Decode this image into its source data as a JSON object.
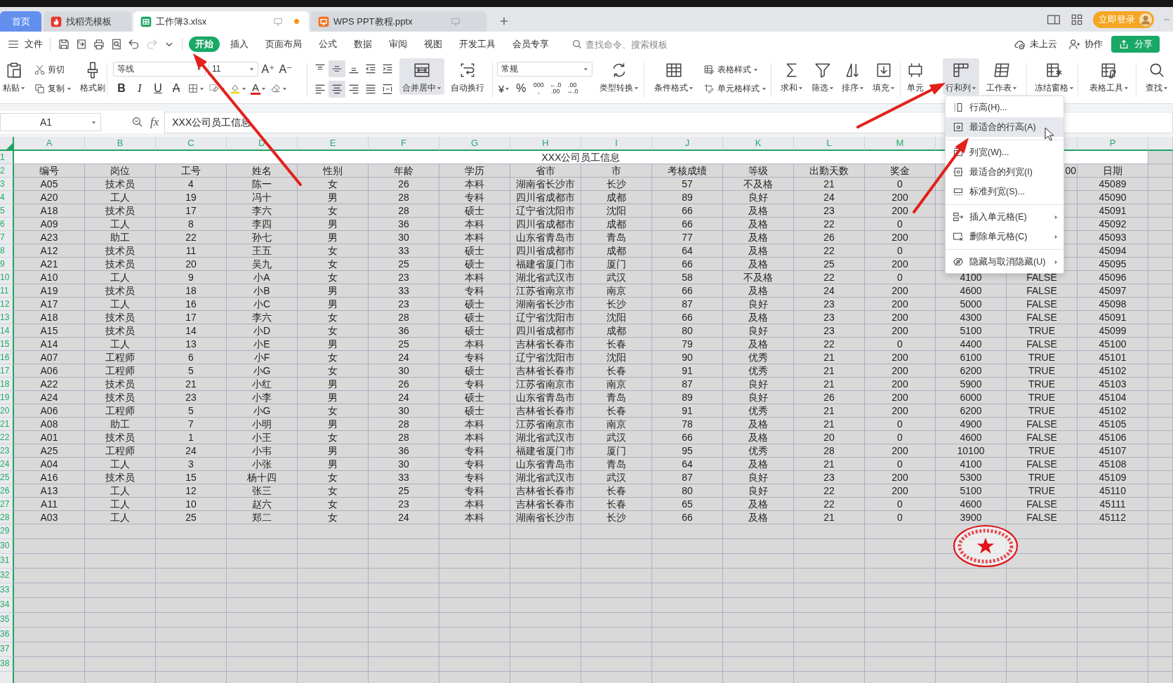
{
  "tab_bar": {
    "tabs": [
      {
        "label": "首页",
        "kind": "home",
        "selected": false
      },
      {
        "label": "找稻壳模板",
        "kind": "template",
        "selected": false
      },
      {
        "label": "工作簿3.xlsx",
        "kind": "sheet",
        "selected": true,
        "modified": true
      },
      {
        "label": "WPS PPT教程.pptx",
        "kind": "slides",
        "selected": false,
        "modified": false
      }
    ],
    "login": "立即登录"
  },
  "menu_bar": {
    "file": "文件",
    "quick_access": [
      {
        "disabled": false
      },
      {
        "disabled": false
      },
      {
        "disabled": false
      },
      {
        "disabled": false
      },
      {
        "disabled": false
      },
      {
        "disabled": true
      },
      {
        "disabled": false
      }
    ],
    "tabs": [
      {
        "label": "开始",
        "selected": true
      },
      {
        "label": "插入",
        "selected": false
      },
      {
        "label": "页面布局",
        "selected": false
      },
      {
        "label": "公式",
        "selected": false
      },
      {
        "label": "数据",
        "selected": false
      },
      {
        "label": "审阅",
        "selected": false
      },
      {
        "label": "视图",
        "selected": false
      },
      {
        "label": "开发工具",
        "selected": false
      },
      {
        "label": "会员专享",
        "selected": false
      }
    ],
    "search": {
      "placeholder": "查找命令、搜索模板"
    },
    "cloud": "未上云",
    "collaborate": "协作",
    "share": "分享"
  },
  "ribbon": {
    "paste": "粘贴",
    "cut": "剪切",
    "copy": "复制",
    "format_painter": "格式刷",
    "font_name": "等线",
    "font_size": "11",
    "grow_font": "A⁺",
    "shrink_font": "A⁻",
    "font_styles": [
      "B",
      "I",
      "U",
      "A"
    ],
    "font_color": "A",
    "align_rows": [
      [
        {
          "selected": false
        },
        {
          "selected": true
        },
        {
          "selected": false
        },
        {
          "selected": false
        },
        {
          "selected": false
        }
      ],
      [
        {
          "selected": false
        },
        {
          "selected": true
        },
        {
          "selected": false
        },
        {
          "selected": false
        },
        {
          "selected": false
        }
      ]
    ],
    "merge_center": {
      "label": "合并居中",
      "selected": true
    },
    "wrap_text": {
      "label": "自动换行",
      "selected": false
    },
    "number_format": "常规",
    "currency": "¥",
    "percent": "%",
    "thousands": [
      "000",
      ","
    ],
    "decimal_more": [
      "←.0",
      ".00"
    ],
    "decimal_less": [
      ".00",
      "→.0"
    ],
    "convert": "类型转换",
    "conditional_format": "条件格式",
    "table_style": "表格样式",
    "cell_style": "单元格样式",
    "tools": [
      {
        "label": "求和"
      },
      {
        "label": "筛选"
      },
      {
        "label": "排序"
      },
      {
        "label": "填充"
      }
    ],
    "cells_tools": [
      {
        "label": "单元",
        "selected": false,
        "dropdown": false
      },
      {
        "label": "行和列",
        "selected": true,
        "dropdown": true
      },
      {
        "label": "工作表",
        "selected": false,
        "dropdown": true
      }
    ],
    "freeze": "冻结窗格",
    "table_tools": "表格工具",
    "find": "查找"
  },
  "formula_bar": {
    "name_box": "A1",
    "function_label": "fx",
    "formula": "XXX公司员工信息"
  },
  "sheet": {
    "column_letters": [
      "A",
      "B",
      "C",
      "D",
      "E",
      "F",
      "G",
      "H",
      "I",
      "J",
      "K",
      "L",
      "M",
      {
        "kind": "covered"
      },
      {
        "kind": "covered"
      },
      "P"
    ],
    "title_row": {
      "number": "1",
      "text": "XXX公司员工信息"
    },
    "rows": [
      {
        "number": "2",
        "cells": [
          "编号",
          "岗位",
          "工号",
          "姓名",
          "性别",
          "年龄",
          "学历",
          "省市",
          "市",
          "考核成绩",
          "等级",
          "出勤天数",
          "奖金",
          {
            "kind": "covered"
          },
          {
            "text": "00",
            "kind": "partial"
          },
          "日期"
        ]
      },
      {
        "number": "3",
        "cells": [
          "A05",
          "技术员",
          "4",
          "陈一",
          "女",
          "26",
          "本科",
          "湖南省长沙市",
          "长沙",
          "57",
          "不及格",
          "21",
          "0",
          {
            "kind": "covered"
          },
          {
            "kind": "covered"
          },
          "45089"
        ]
      },
      {
        "number": "4",
        "cells": [
          "A20",
          "工人",
          "19",
          "冯十",
          "男",
          "28",
          "专科",
          "四川省成都市",
          "成都",
          "89",
          "良好",
          "24",
          "200",
          {
            "kind": "covered"
          },
          {
            "kind": "covered"
          },
          "45090"
        ]
      },
      {
        "number": "5",
        "cells": [
          "A18",
          "技术员",
          "17",
          "李六",
          "女",
          "28",
          "硕士",
          "辽宁省沈阳市",
          "沈阳",
          "66",
          "及格",
          "23",
          "200",
          {
            "kind": "covered"
          },
          {
            "kind": "covered"
          },
          "45091"
        ]
      },
      {
        "number": "6",
        "cells": [
          "A09",
          "工人",
          "8",
          "李四",
          "男",
          "36",
          "本科",
          "四川省成都市",
          "成都",
          "66",
          "及格",
          "22",
          "0",
          {
            "kind": "covered"
          },
          {
            "kind": "covered"
          },
          "45092"
        ]
      },
      {
        "number": "7",
        "cells": [
          "A23",
          "助工",
          "22",
          "孙七",
          "男",
          "30",
          "本科",
          "山东省青岛市",
          "青岛",
          "77",
          "及格",
          "26",
          "200",
          {
            "kind": "covered"
          },
          {
            "kind": "covered"
          },
          "45093"
        ]
      },
      {
        "number": "8",
        "cells": [
          "A12",
          "技术员",
          "11",
          "王五",
          "女",
          "33",
          "硕士",
          "四川省成都市",
          "成都",
          "64",
          "及格",
          "22",
          "0",
          {
            "kind": "covered"
          },
          {
            "kind": "covered"
          },
          "45094"
        ]
      },
      {
        "number": "9",
        "cells": [
          "A21",
          "技术员",
          "20",
          "吴九",
          "女",
          "25",
          "硕士",
          "福建省厦门市",
          "厦门",
          "66",
          "及格",
          "25",
          "200",
          {
            "kind": "covered"
          },
          {
            "kind": "covered"
          },
          "45095"
        ]
      },
      {
        "number": "10",
        "cells": [
          "A10",
          "工人",
          "9",
          "小A",
          "女",
          "23",
          "本科",
          "湖北省武汉市",
          "武汉",
          "58",
          "不及格",
          "22",
          "0",
          "4100",
          "FALSE",
          "45096"
        ]
      },
      {
        "number": "11",
        "cells": [
          "A19",
          "技术员",
          "18",
          "小B",
          "男",
          "33",
          "专科",
          "江苏省南京市",
          "南京",
          "66",
          "及格",
          "24",
          "200",
          "4600",
          "FALSE",
          "45097"
        ]
      },
      {
        "number": "12",
        "cells": [
          "A17",
          "工人",
          "16",
          "小C",
          "男",
          "23",
          "硕士",
          "湖南省长沙市",
          "长沙",
          "87",
          "良好",
          "23",
          "200",
          "5000",
          "FALSE",
          "45098"
        ]
      },
      {
        "number": "13",
        "cells": [
          "A18",
          "技术员",
          "17",
          "李六",
          "女",
          "28",
          "硕士",
          "辽宁省沈阳市",
          "沈阳",
          "66",
          "及格",
          "23",
          "200",
          "4300",
          "FALSE",
          "45091"
        ]
      },
      {
        "number": "14",
        "cells": [
          "A15",
          "技术员",
          "14",
          "小D",
          "女",
          "36",
          "硕士",
          "四川省成都市",
          "成都",
          "80",
          "良好",
          "23",
          "200",
          "5100",
          "TRUE",
          "45099"
        ]
      },
      {
        "number": "15",
        "cells": [
          "A14",
          "工人",
          "13",
          "小E",
          "男",
          "25",
          "本科",
          "吉林省长春市",
          "长春",
          "79",
          "及格",
          "22",
          "0",
          "4400",
          "FALSE",
          "45100"
        ]
      },
      {
        "number": "16",
        "cells": [
          "A07",
          "工程师",
          "6",
          "小F",
          "女",
          "24",
          "专科",
          "辽宁省沈阳市",
          "沈阳",
          "90",
          "优秀",
          "21",
          "200",
          "6100",
          "TRUE",
          "45101"
        ]
      },
      {
        "number": "17",
        "cells": [
          "A06",
          "工程师",
          "5",
          "小G",
          "女",
          "30",
          "硕士",
          "吉林省长春市",
          "长春",
          "91",
          "优秀",
          "21",
          "200",
          "6200",
          "TRUE",
          "45102"
        ]
      },
      {
        "number": "18",
        "cells": [
          "A22",
          "技术员",
          "21",
          "小红",
          "男",
          "26",
          "专科",
          "江苏省南京市",
          "南京",
          "87",
          "良好",
          "21",
          "200",
          "5900",
          "TRUE",
          "45103"
        ]
      },
      {
        "number": "19",
        "cells": [
          "A24",
          "技术员",
          "23",
          "小李",
          "男",
          "24",
          "硕士",
          "山东省青岛市",
          "青岛",
          "89",
          "良好",
          "26",
          "200",
          "6000",
          "TRUE",
          "45104"
        ]
      },
      {
        "number": "20",
        "cells": [
          "A06",
          "工程师",
          "5",
          "小G",
          "女",
          "30",
          "硕士",
          "吉林省长春市",
          "长春",
          "91",
          "优秀",
          "21",
          "200",
          "6200",
          "TRUE",
          "45102"
        ]
      },
      {
        "number": "21",
        "cells": [
          "A08",
          "助工",
          "7",
          "小明",
          "男",
          "28",
          "本科",
          "江苏省南京市",
          "南京",
          "78",
          "及格",
          "21",
          "0",
          "4900",
          "FALSE",
          "45105"
        ]
      },
      {
        "number": "22",
        "cells": [
          "A01",
          "技术员",
          "1",
          "小王",
          "女",
          "28",
          "本科",
          "湖北省武汉市",
          "武汉",
          "66",
          "及格",
          "20",
          "0",
          "4600",
          "FALSE",
          "45106"
        ]
      },
      {
        "number": "23",
        "cells": [
          "A25",
          "工程师",
          "24",
          "小韦",
          "男",
          "36",
          "专科",
          "福建省厦门市",
          "厦门",
          "95",
          "优秀",
          "28",
          "200",
          "10100",
          "TRUE",
          "45107"
        ]
      },
      {
        "number": "24",
        "cells": [
          "A04",
          "工人",
          "3",
          "小张",
          "男",
          "30",
          "专科",
          "山东省青岛市",
          "青岛",
          "64",
          "及格",
          "21",
          "0",
          "4100",
          "FALSE",
          "45108"
        ]
      },
      {
        "number": "25",
        "cells": [
          "A16",
          "技术员",
          "15",
          "杨十四",
          "女",
          "33",
          "专科",
          "湖北省武汉市",
          "武汉",
          "87",
          "良好",
          "23",
          "200",
          "5300",
          "TRUE",
          "45109"
        ]
      },
      {
        "number": "26",
        "cells": [
          "A13",
          "工人",
          "12",
          "张三",
          "女",
          "25",
          "专科",
          "吉林省长春市",
          "长春",
          "80",
          "良好",
          "22",
          "200",
          "5100",
          "TRUE",
          "45110"
        ]
      },
      {
        "number": "27",
        "cells": [
          "A11",
          "工人",
          "10",
          "赵六",
          "女",
          "23",
          "本科",
          "吉林省长春市",
          "长春",
          "65",
          "及格",
          "22",
          "0",
          "4600",
          "FALSE",
          "45111"
        ]
      },
      {
        "number": "28",
        "cells": [
          "A03",
          "工人",
          "25",
          "郑二",
          "女",
          "24",
          "本科",
          "湖南省长沙市",
          "长沙",
          "66",
          "及格",
          "21",
          "0",
          "3900",
          "FALSE",
          "45112"
        ]
      }
    ],
    "empty_rows": [
      "29",
      "30",
      "31",
      "32",
      "33",
      "34",
      "35",
      "36",
      "37",
      "38"
    ]
  },
  "context_menu": {
    "groups": [
      [
        {
          "label": "行高(H)...",
          "selected": false,
          "submenu": false
        },
        {
          "label": "最适合的行高(A)",
          "selected": true,
          "submenu": false
        }
      ],
      [
        {
          "label": "列宽(W)...",
          "selected": false,
          "submenu": false
        },
        {
          "label": "最适合的列宽(I)",
          "selected": false,
          "submenu": false
        },
        {
          "label": "标准列宽(S)...",
          "selected": false,
          "submenu": false
        }
      ],
      [
        {
          "label": "插入单元格(E)",
          "selected": false,
          "submenu": true
        },
        {
          "label": "删除单元格(C)",
          "selected": false,
          "submenu": true
        }
      ],
      [
        {
          "label": "隐藏与取消隐藏(U)",
          "selected": false,
          "submenu": true
        }
      ]
    ]
  }
}
